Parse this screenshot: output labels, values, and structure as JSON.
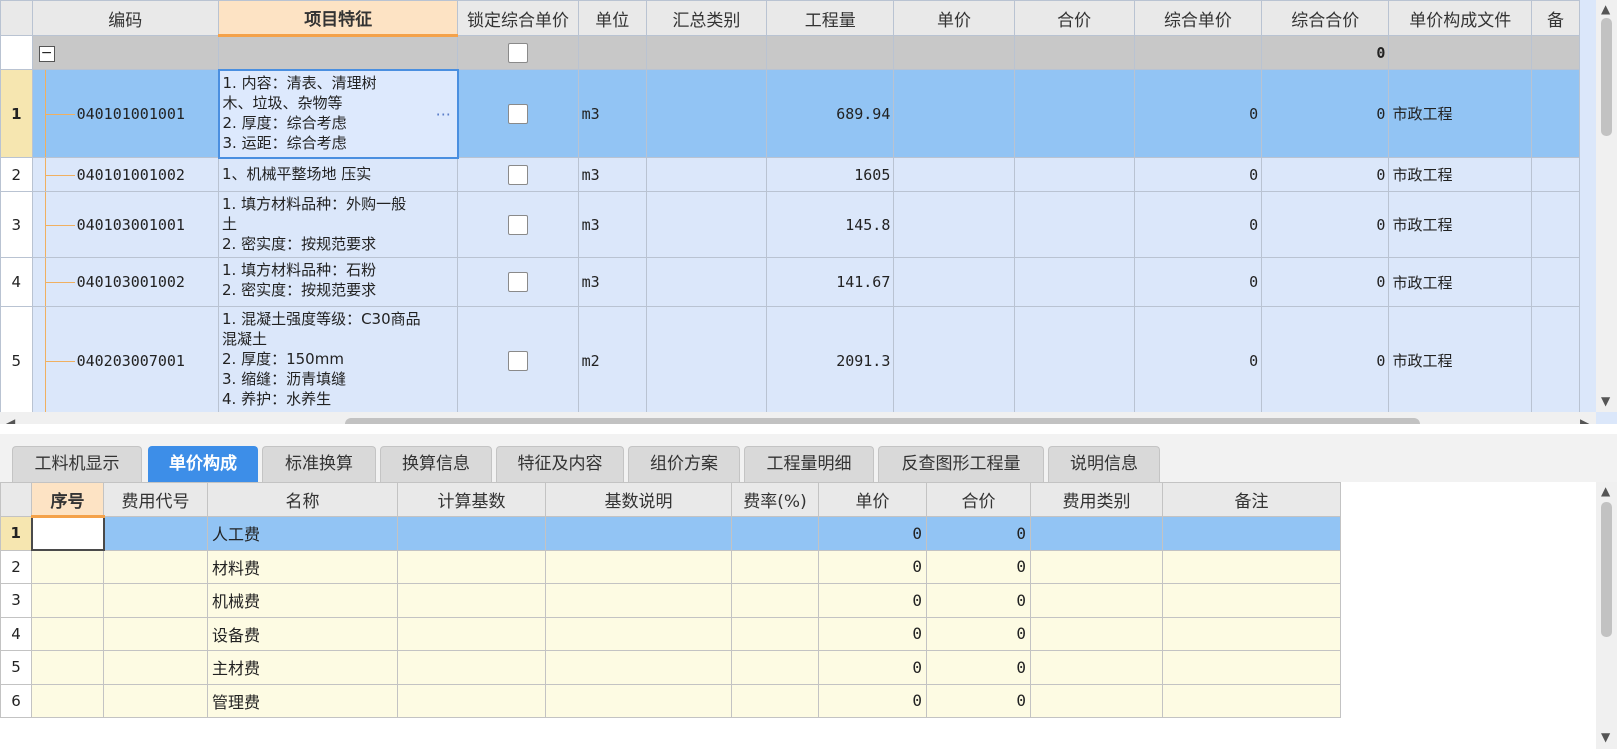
{
  "upper_grid": {
    "columns": [
      "编码",
      "项目特征",
      "锁定综合单价",
      "单位",
      "汇总类别",
      "工程量",
      "单价",
      "合价",
      "综合单价",
      "综合合价",
      "单价构成文件",
      "备"
    ],
    "group_row": {
      "collapse_symbol": "−",
      "total": "0"
    },
    "rows": [
      {
        "index": "1",
        "code": "040101001001",
        "feature": "1. 内容：清表、清理树\n木、垃圾、杂物等\n2. 厚度：综合考虑\n3. 运距：综合考虑",
        "unit": "m3",
        "quantity": "689.94",
        "composite_price": "0",
        "composite_total": "0",
        "price_file": "市政工程",
        "edit_ellipsis": "···"
      },
      {
        "index": "2",
        "code": "040101001002",
        "feature": "1、机械平整场地 压实",
        "unit": "m3",
        "quantity": "1605",
        "composite_price": "0",
        "composite_total": "0",
        "price_file": "市政工程"
      },
      {
        "index": "3",
        "code": "040103001001",
        "feature": "1. 填方材料品种：外购一般\n土\n2. 密实度：按规范要求",
        "unit": "m3",
        "quantity": "145.8",
        "composite_price": "0",
        "composite_total": "0",
        "price_file": "市政工程"
      },
      {
        "index": "4",
        "code": "040103001002",
        "feature": "1. 填方材料品种：石粉\n2. 密实度：按规范要求",
        "unit": "m3",
        "quantity": "141.67",
        "composite_price": "0",
        "composite_total": "0",
        "price_file": "市政工程"
      },
      {
        "index": "5",
        "code": "040203007001",
        "feature": "1. 混凝土强度等级：C30商品\n混凝土\n2. 厚度：150mm\n3. 缩缝：沥青填缝\n4. 养护：水养生",
        "unit": "m2",
        "quantity": "2091.3",
        "composite_price": "0",
        "composite_total": "0",
        "price_file": "市政工程"
      }
    ]
  },
  "tabs": [
    "工料机显示",
    "单价构成",
    "标准换算",
    "换算信息",
    "特征及内容",
    "组价方案",
    "工程量明细",
    "反查图形工程量",
    "说明信息"
  ],
  "active_tab": "单价构成",
  "lower_grid": {
    "columns": [
      "序号",
      "费用代号",
      "名称",
      "计算基数",
      "基数说明",
      "费率(%)",
      "单价",
      "合价",
      "费用类别",
      "备注"
    ],
    "rows": [
      {
        "index": "1",
        "name": "人工费",
        "unit_price": "0",
        "total": "0"
      },
      {
        "index": "2",
        "name": "材料费",
        "unit_price": "0",
        "total": "0"
      },
      {
        "index": "3",
        "name": "机械费",
        "unit_price": "0",
        "total": "0"
      },
      {
        "index": "4",
        "name": "设备费",
        "unit_price": "0",
        "total": "0"
      },
      {
        "index": "5",
        "name": "主材费",
        "unit_price": "0",
        "total": "0"
      },
      {
        "index": "6",
        "name": "管理费",
        "unit_price": "0",
        "total": "0"
      }
    ]
  },
  "scroll_arrows": {
    "up": "▲",
    "down": "▼",
    "left": "◀",
    "right": "▶"
  }
}
